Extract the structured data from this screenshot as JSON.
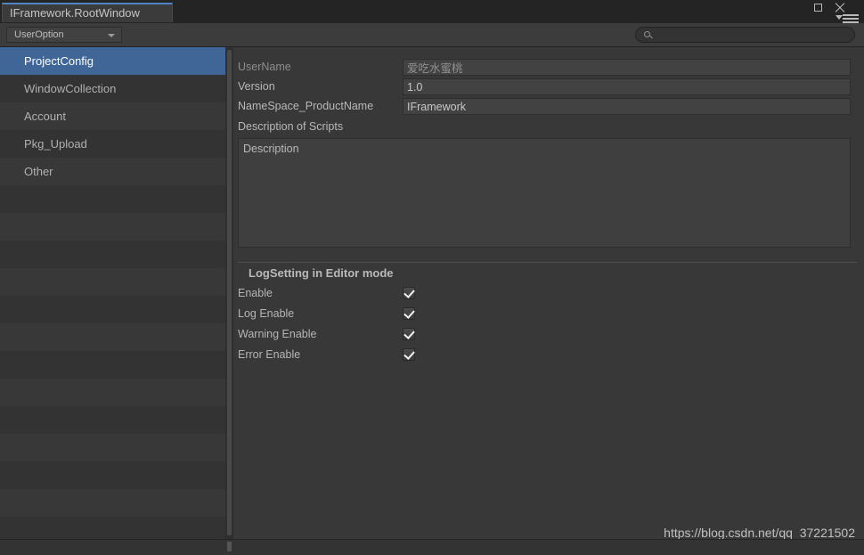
{
  "window": {
    "tab_title": "IFramework.RootWindow",
    "controls": {
      "maximize_icon": "maximize-box-icon",
      "close_icon": "close-x-icon",
      "menu_icon": "hamburger-menu-icon"
    },
    "accent_color": "#4f83c4"
  },
  "toolbar": {
    "dropdown_label": "UserOption",
    "dropdown_arrow_icon": "chevron-down-icon",
    "search": {
      "icon": "search-magnifier-icon",
      "value": "",
      "placeholder": ""
    }
  },
  "sidebar": {
    "items": [
      {
        "label": "ProjectConfig",
        "selected": true
      },
      {
        "label": "WindowCollection",
        "selected": false
      },
      {
        "label": "Account",
        "selected": false
      },
      {
        "label": "Pkg_Upload",
        "selected": false
      },
      {
        "label": "Other",
        "selected": false
      }
    ],
    "empty_row_count": 13,
    "selected_color": "#3f6697"
  },
  "panel": {
    "fields": [
      {
        "label": "UserName",
        "value": "爱吃水蜜桃",
        "dim": true
      },
      {
        "label": "Version",
        "value": "1.0",
        "dim": false
      },
      {
        "label": "NameSpace_ProductName",
        "value": "IFramework",
        "dim": false
      }
    ],
    "description_section_label": "Description of Scripts",
    "description_value": "Description",
    "log_section": {
      "title": "LogSetting in Editor mode",
      "options": [
        {
          "label": "Enable",
          "checked": true
        },
        {
          "label": "Log Enable",
          "checked": true
        },
        {
          "label": "Warning Enable",
          "checked": true
        },
        {
          "label": "Error Enable",
          "checked": true
        }
      ]
    }
  },
  "watermark": "https://blog.csdn.net/qq_37221502"
}
